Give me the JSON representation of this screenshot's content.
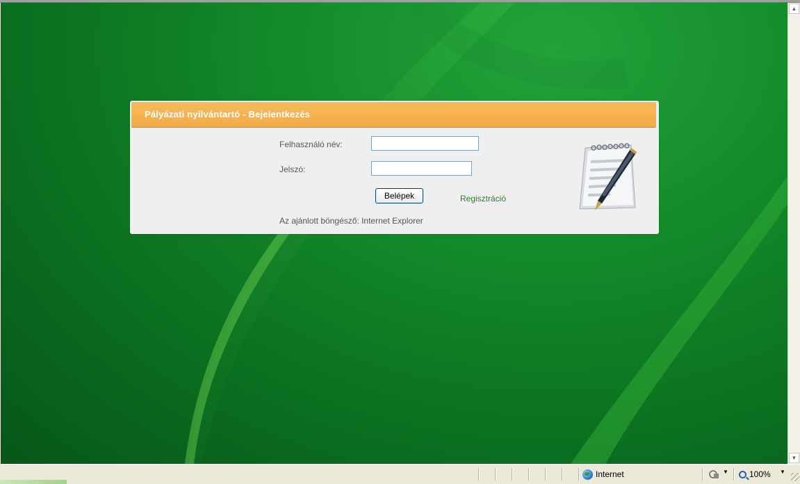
{
  "login": {
    "title": "Pályázati nyilvántartó - Bejelentkezés",
    "username_label": "Felhasználó név:",
    "username_value": "",
    "password_label": "Jelszó:",
    "password_value": "",
    "login_button": "Belépek",
    "register_link": "Regisztráció",
    "browser_note": "Az ajánlott böngésző: Internet Explorer",
    "header_color": "#f4b04f",
    "link_color": "#2a7a2a"
  },
  "statusbar": {
    "zone": "Internet",
    "zoom": "100%"
  },
  "icons": {
    "scroll_up": "▲",
    "scroll_down": "▼",
    "dropdown": "▼"
  }
}
